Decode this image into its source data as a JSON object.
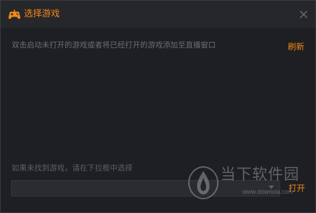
{
  "window": {
    "title": "选择游戏",
    "title_icon": "gamepad-icon",
    "close_icon": "close-icon"
  },
  "main": {
    "hint_text": "双击启动未打开的游戏或者将已经打开的游戏添加至直播窗口",
    "refresh_label": "刷新",
    "fallback_hint": "如果未找到游戏，请在下拉框中选择",
    "dropdown_value": "",
    "open_label": "打开"
  },
  "watermark": {
    "brand": "当下软件园",
    "url": "www.downxia.com"
  },
  "colors": {
    "accent": "#f08a1c",
    "background": "#1e1f22",
    "titlebar": "#26272b"
  }
}
